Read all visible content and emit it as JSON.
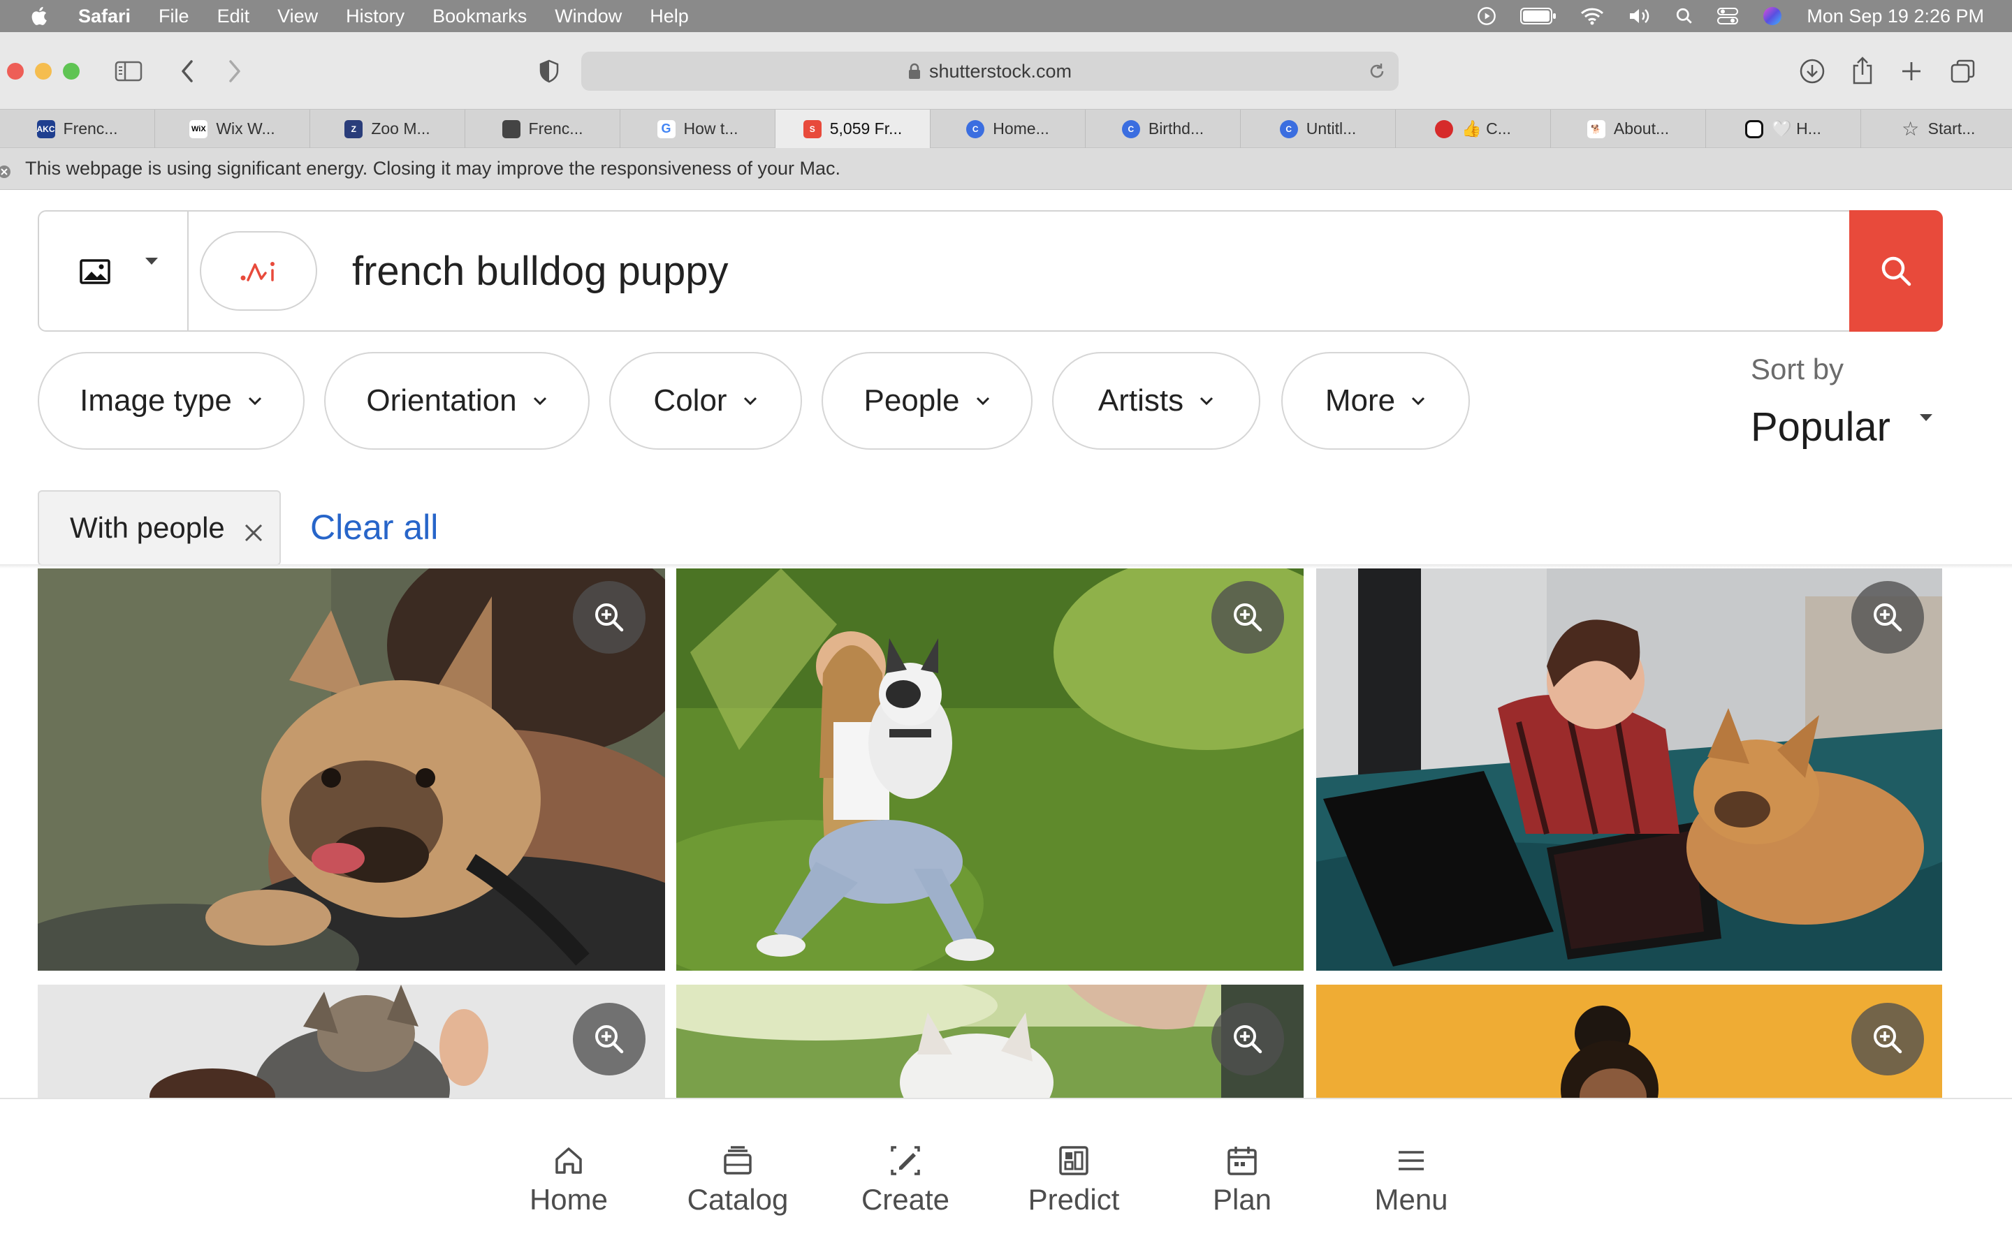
{
  "menubar": {
    "app": "Safari",
    "items": [
      "File",
      "Edit",
      "View",
      "History",
      "Bookmarks",
      "Window",
      "Help"
    ],
    "clock": "Mon Sep 19  2:26 PM",
    "status_icons": [
      "play-icon",
      "battery-icon",
      "wifi-icon",
      "volume-icon",
      "spotlight-icon",
      "control-center-icon",
      "siri-icon"
    ]
  },
  "browser": {
    "url": "shutterstock.com",
    "tabs": [
      {
        "label": "Frenc...",
        "favicon": "AKC",
        "color": "#1f3f8f"
      },
      {
        "label": "Wix W...",
        "favicon": "WiX",
        "color": "#ffffff"
      },
      {
        "label": "Zoo M...",
        "favicon": "Z",
        "color": "#2a3d7a"
      },
      {
        "label": "Frenc...",
        "favicon": "",
        "color": "#444444"
      },
      {
        "label": "How t...",
        "favicon": "G",
        "color": "#ffffff"
      },
      {
        "label": "5,059 Fr...",
        "favicon": "S",
        "color": "#e84a3b"
      },
      {
        "label": "Home...",
        "favicon": "C",
        "color": "#3b6ee0"
      },
      {
        "label": "Birthd...",
        "favicon": "C",
        "color": "#3b6ee0"
      },
      {
        "label": "Untitl...",
        "favicon": "C",
        "color": "#3b6ee0"
      },
      {
        "label": "👍 C...",
        "favicon": "",
        "color": "#d62b2b"
      },
      {
        "label": "About...",
        "favicon": "",
        "color": "#ffffff"
      },
      {
        "label": "🤍 H...",
        "favicon": "",
        "color": "#ffffff"
      },
      {
        "label": "Start...",
        "favicon": "☆",
        "color": "#d4d4d4"
      }
    ],
    "active_tab_index": 5
  },
  "banner": {
    "text": "This webpage is using significant energy. Closing it may improve the responsiveness of your Mac."
  },
  "search": {
    "query": "french bulldog puppy",
    "ai_logo": ".ʌi"
  },
  "filters": [
    {
      "label": "Image type"
    },
    {
      "label": "Orientation"
    },
    {
      "label": "Color"
    },
    {
      "label": "People"
    },
    {
      "label": "Artists"
    },
    {
      "label": "More"
    }
  ],
  "sort": {
    "label": "Sort by",
    "value": "Popular"
  },
  "active_filter": {
    "label": "With people",
    "clear_label": "Clear all"
  },
  "nav": [
    {
      "label": "Home",
      "icon": "home-icon"
    },
    {
      "label": "Catalog",
      "icon": "catalog-icon"
    },
    {
      "label": "Create",
      "icon": "create-icon"
    },
    {
      "label": "Predict",
      "icon": "predict-icon"
    },
    {
      "label": "Plan",
      "icon": "calendar-icon"
    },
    {
      "label": "Menu",
      "icon": "menu-icon"
    }
  ],
  "colors": {
    "accent": "#e84a3b",
    "link": "#2765c9"
  }
}
